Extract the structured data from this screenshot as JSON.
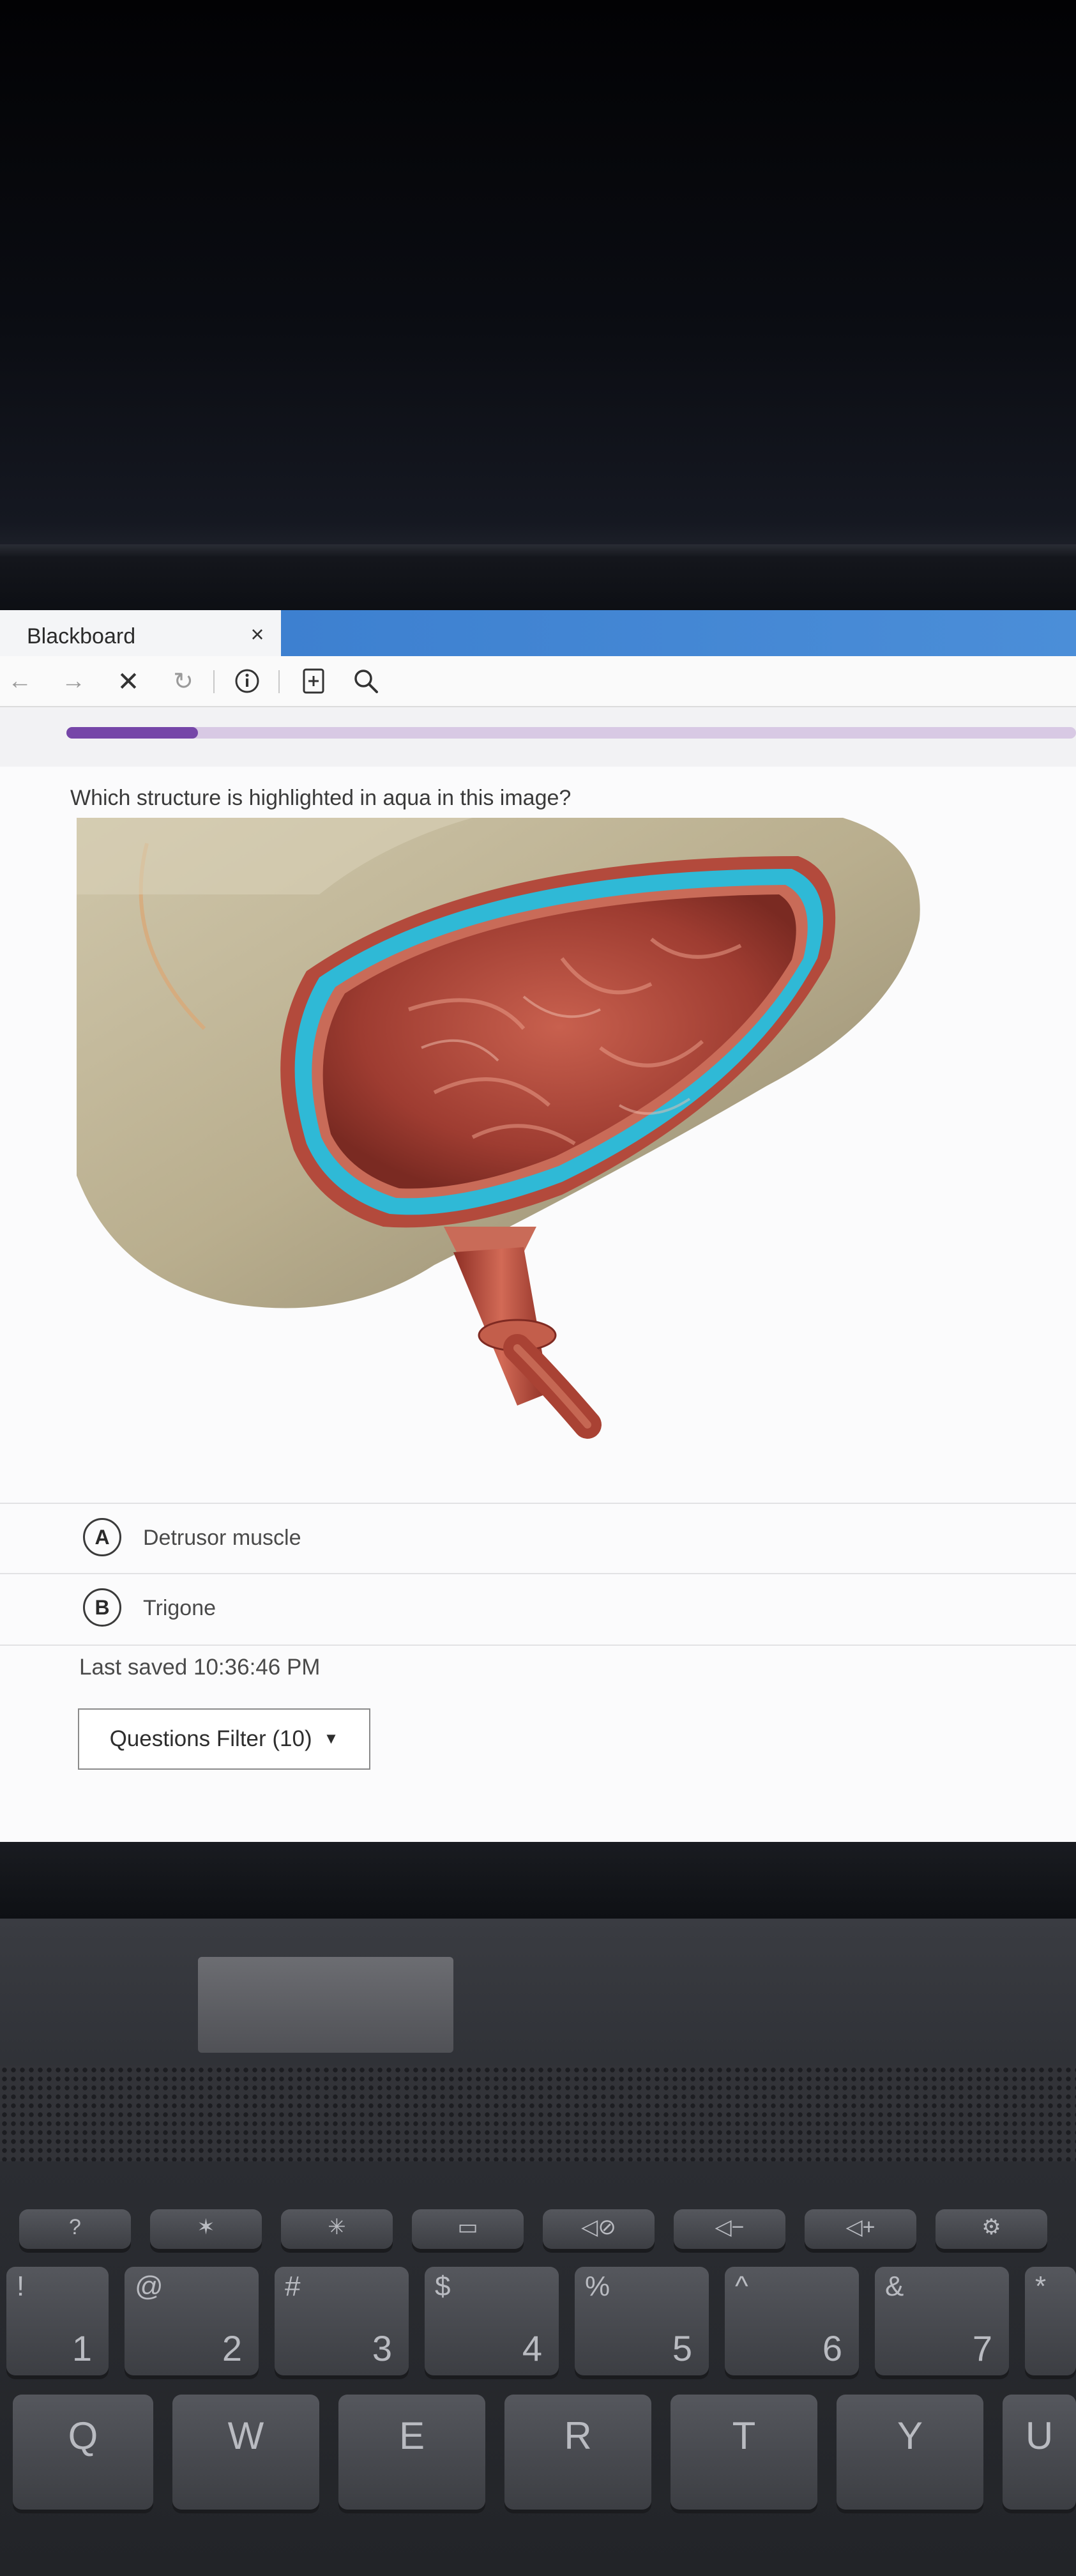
{
  "browser": {
    "tab_title": "Blackboard",
    "tab_close_icon": "close-icon",
    "nav_icons": [
      "back-arrow-icon",
      "forward-arrow-icon",
      "stop-icon",
      "reload-icon",
      "info-icon",
      "add-page-icon",
      "search-icon"
    ]
  },
  "quiz": {
    "progress_fraction": 0.13,
    "question": "Which structure is highlighted in aqua in this image?",
    "options": [
      {
        "letter": "A",
        "text": "Detrusor muscle"
      },
      {
        "letter": "B",
        "text": "Trigone"
      }
    ],
    "last_saved": "Last saved 10:36:46 PM",
    "filter_button": "Questions Filter (10)"
  },
  "colors": {
    "highlight_aqua": "#2fb9d6",
    "bladder_red": "#b04a3d",
    "progress_purple": "#7646a8",
    "browser_blue": "#4586d4"
  },
  "keyboard": {
    "function_keys": [
      "?",
      "✶",
      "✳",
      "▭",
      "◁⊘",
      "◁−",
      "◁+",
      "⚙"
    ],
    "number_keys": [
      {
        "top": "!",
        "main": "1"
      },
      {
        "top": "@",
        "main": "2"
      },
      {
        "top": "#",
        "main": "3"
      },
      {
        "top": "$",
        "main": "4"
      },
      {
        "top": "%",
        "main": "5"
      },
      {
        "top": "^",
        "main": "6"
      },
      {
        "top": "&",
        "main": "7"
      },
      {
        "top": "*",
        "main": ""
      }
    ],
    "letter_keys": [
      "Q",
      "W",
      "E",
      "R",
      "T",
      "Y",
      "U"
    ]
  }
}
